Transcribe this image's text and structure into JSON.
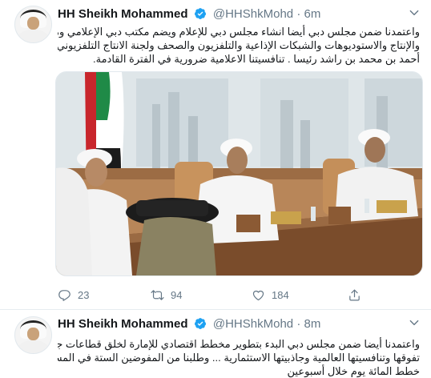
{
  "tweets": [
    {
      "author": {
        "name": "HH Sheikh Mohammed",
        "handle": "@HHShkMohd",
        "separator": "·",
        "time": "6m"
      },
      "text_lines": [
        "واعتمدنا ضمن مجلس دبي أيضا انشاء مجلس دبي للإعلام ويضم مكتب دبي الإعلامي ومدن الاعلام",
        "والإنتاج والاستوديوهات والشبكات الإذاعية والتلفزيون والصحف ولجنة الانتاج التلفزيوني والسينمائي.",
        "أحمد بن محمد بن راشد رئيسا . تنافسيتنا الاعلامية ضرورية في الفترة القادمة."
      ],
      "actions": {
        "replies": "23",
        "retweets": "94",
        "likes": "184"
      }
    },
    {
      "author": {
        "name": "HH Sheikh Mohammed",
        "handle": "@HHShkMohd",
        "separator": "·",
        "time": "8m"
      },
      "text_lines": [
        "واعتمدنا أيضا ضمن مجلس دبي البدء بتطوير مخطط اقتصادي للإمارة لخلق قطاعات جديدة بما يضمن",
        "تفوقها وتنافسيتها العالمية وجاذبيتها الاستثمارية ... وطلبنا من المفوضين الستة في المسارات التنموية تسليم",
        "خطط المائة يوم خلال أسبوعين"
      ]
    }
  ],
  "colors": {
    "verified": "#1da1f2",
    "muted": "#657786",
    "text": "#14171a",
    "border": "#e6ecf0"
  },
  "icons": {
    "verified": "verified-badge-icon",
    "menu": "chevron-down-icon",
    "reply": "reply-icon",
    "retweet": "retweet-icon",
    "like": "heart-icon"
  }
}
